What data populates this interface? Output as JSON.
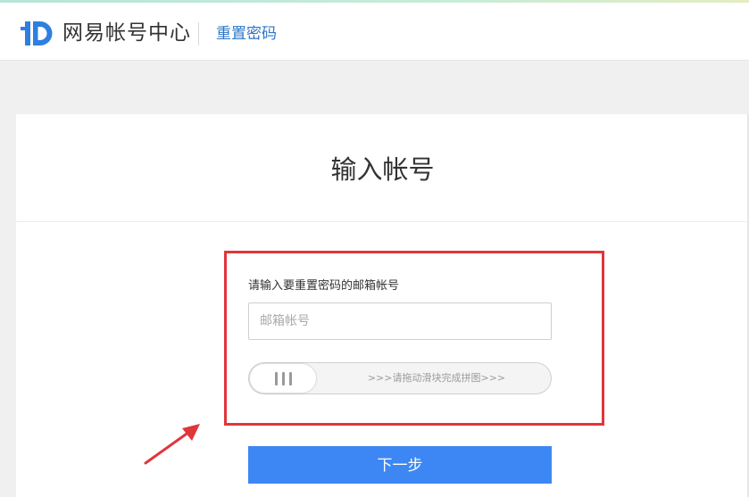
{
  "header": {
    "brand": "网易帐号中心",
    "page_name": "重置密码",
    "logo_icon": "netease-id-logo-icon",
    "accent_color": "#2b76c7"
  },
  "card": {
    "title": "输入帐号",
    "form": {
      "label": "请输入要重置密码的邮箱帐号",
      "email_placeholder": "邮箱帐号",
      "email_value": "",
      "slider_hint": ">>>请拖动滑块完成拼图>>>",
      "next_label": "下一步",
      "button_color": "#3c87f4"
    }
  },
  "annotation": {
    "highlight_color": "#e0363b"
  }
}
